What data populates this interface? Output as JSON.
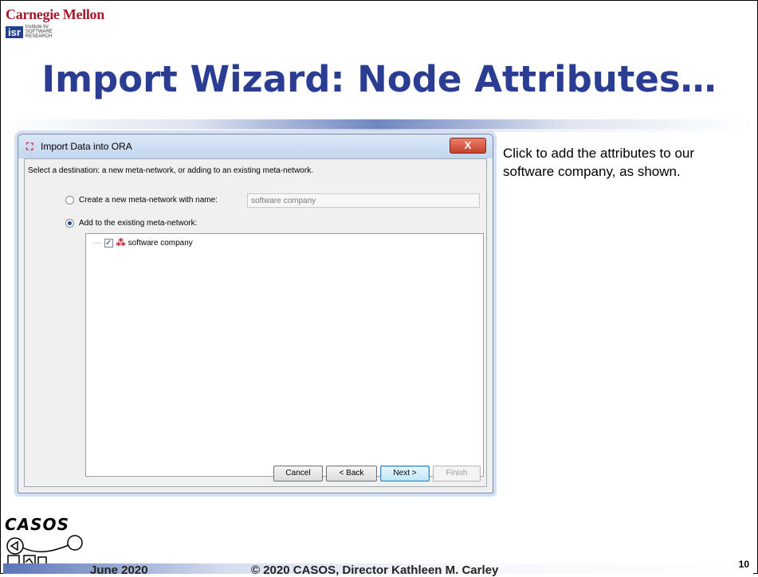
{
  "header": {
    "org_name": "Carnegie Mellon",
    "isr_badge": "isr",
    "isr_subtitle_1": "institute for",
    "isr_subtitle_2": "SOFTWARE",
    "isr_subtitle_3": "RESEARCH"
  },
  "slide": {
    "title": "Import Wizard: Node Attributes…",
    "caption": "Click to add the attributes to our software company, as shown.",
    "page_number": "10"
  },
  "dialog": {
    "title": "Import Data into ORA",
    "close_label": "X",
    "instruction": "Select a destination: a new meta-network, or adding to an existing meta-network.",
    "option_new_label": "Create a new meta-network with name:",
    "option_new_selected": false,
    "new_name_value": "software company",
    "option_existing_label": "Add to the existing meta-network:",
    "option_existing_selected": true,
    "tree_items": [
      {
        "label": "software company",
        "checked": true
      }
    ],
    "buttons": {
      "cancel": "Cancel",
      "back": "< Back",
      "next": "Next >",
      "finish": "Finish"
    }
  },
  "footer": {
    "logo_text": "CASOS",
    "date": "June 2020",
    "copyright": "© 2020 CASOS, Director Kathleen M. Carley"
  },
  "colors": {
    "title_blue": "#2b3d93",
    "cmu_red": "#a6192e",
    "isr_blue": "#1f3f8f"
  }
}
